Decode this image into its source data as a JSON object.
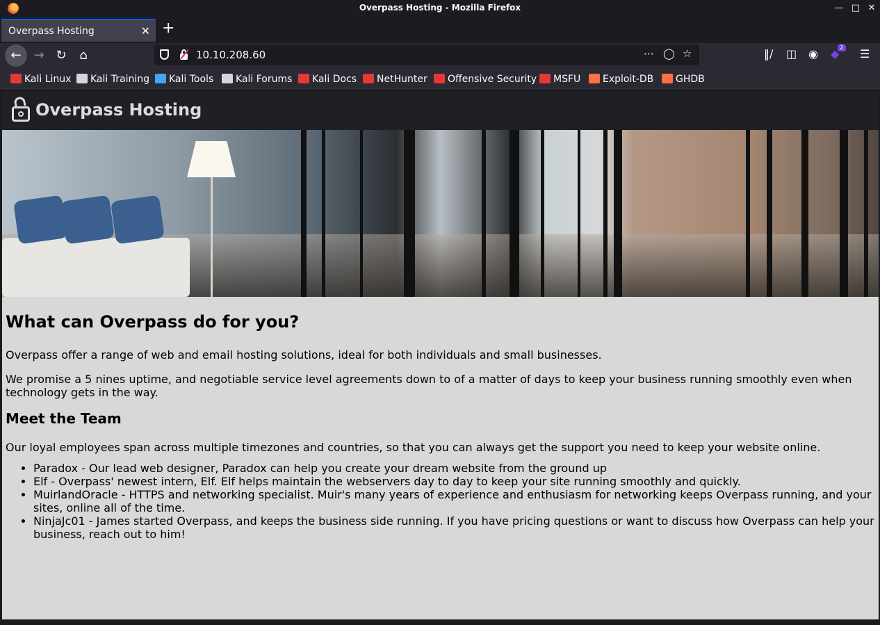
{
  "window": {
    "title": "Overpass Hosting - Mozilla Firefox"
  },
  "tabs": [
    {
      "label": "Overpass Hosting"
    }
  ],
  "address_bar": {
    "url": "10.10.208.60"
  },
  "extension_badge": "2",
  "bookmarks": [
    {
      "label": "Kali Linux",
      "icon_color": "#e53935"
    },
    {
      "label": "Kali Training",
      "icon_color": "#cfd8dc"
    },
    {
      "label": "Kali Tools",
      "icon_color": "#42a5f5"
    },
    {
      "label": "Kali Forums",
      "icon_color": "#cfd8dc"
    },
    {
      "label": "Kali Docs",
      "icon_color": "#e53935"
    },
    {
      "label": "NetHunter",
      "icon_color": "#e53935"
    },
    {
      "label": "Offensive Security",
      "icon_color": "#e53935"
    },
    {
      "label": "MSFU",
      "icon_color": "#e53935"
    },
    {
      "label": "Exploit-DB",
      "icon_color": "#ff7043"
    },
    {
      "label": "GHDB",
      "icon_color": "#ff7043"
    }
  ],
  "site": {
    "brand": "Overpass Hosting",
    "heading": "What can Overpass do for you?",
    "intro": "Overpass offer a range of web and email hosting solutions, ideal for both individuals and small businesses.",
    "promise": "We promise a 5 nines uptime, and negotiable service level agreements down to of a matter of days to keep your business running smoothly even when technology gets in the way.",
    "team_heading": "Meet the Team",
    "team_intro": "Our loyal employees span across multiple timezones and countries, so that you can always get the support you need to keep your website online.",
    "team": [
      "Paradox - Our lead web designer, Paradox can help you create your dream website from the ground up",
      "Elf - Overpass' newest intern, Elf. Elf helps maintain the webservers day to day to keep your site running smoothly and quickly.",
      "MuirlandOracle - HTTPS and networking specialist. Muir's many years of experience and enthusiasm for networking keeps Overpass running, and your sites, online all of the time.",
      "NinjaJc01 - James started Overpass, and keeps the business side running. If you have pricing questions or want to discuss how Overpass can help your business, reach out to him!"
    ]
  },
  "colors": {
    "browser_chrome": "#2b2a33",
    "titlebar": "#1c1b22",
    "page_background": "#d8d8d8",
    "site_header": "#1e2025"
  }
}
